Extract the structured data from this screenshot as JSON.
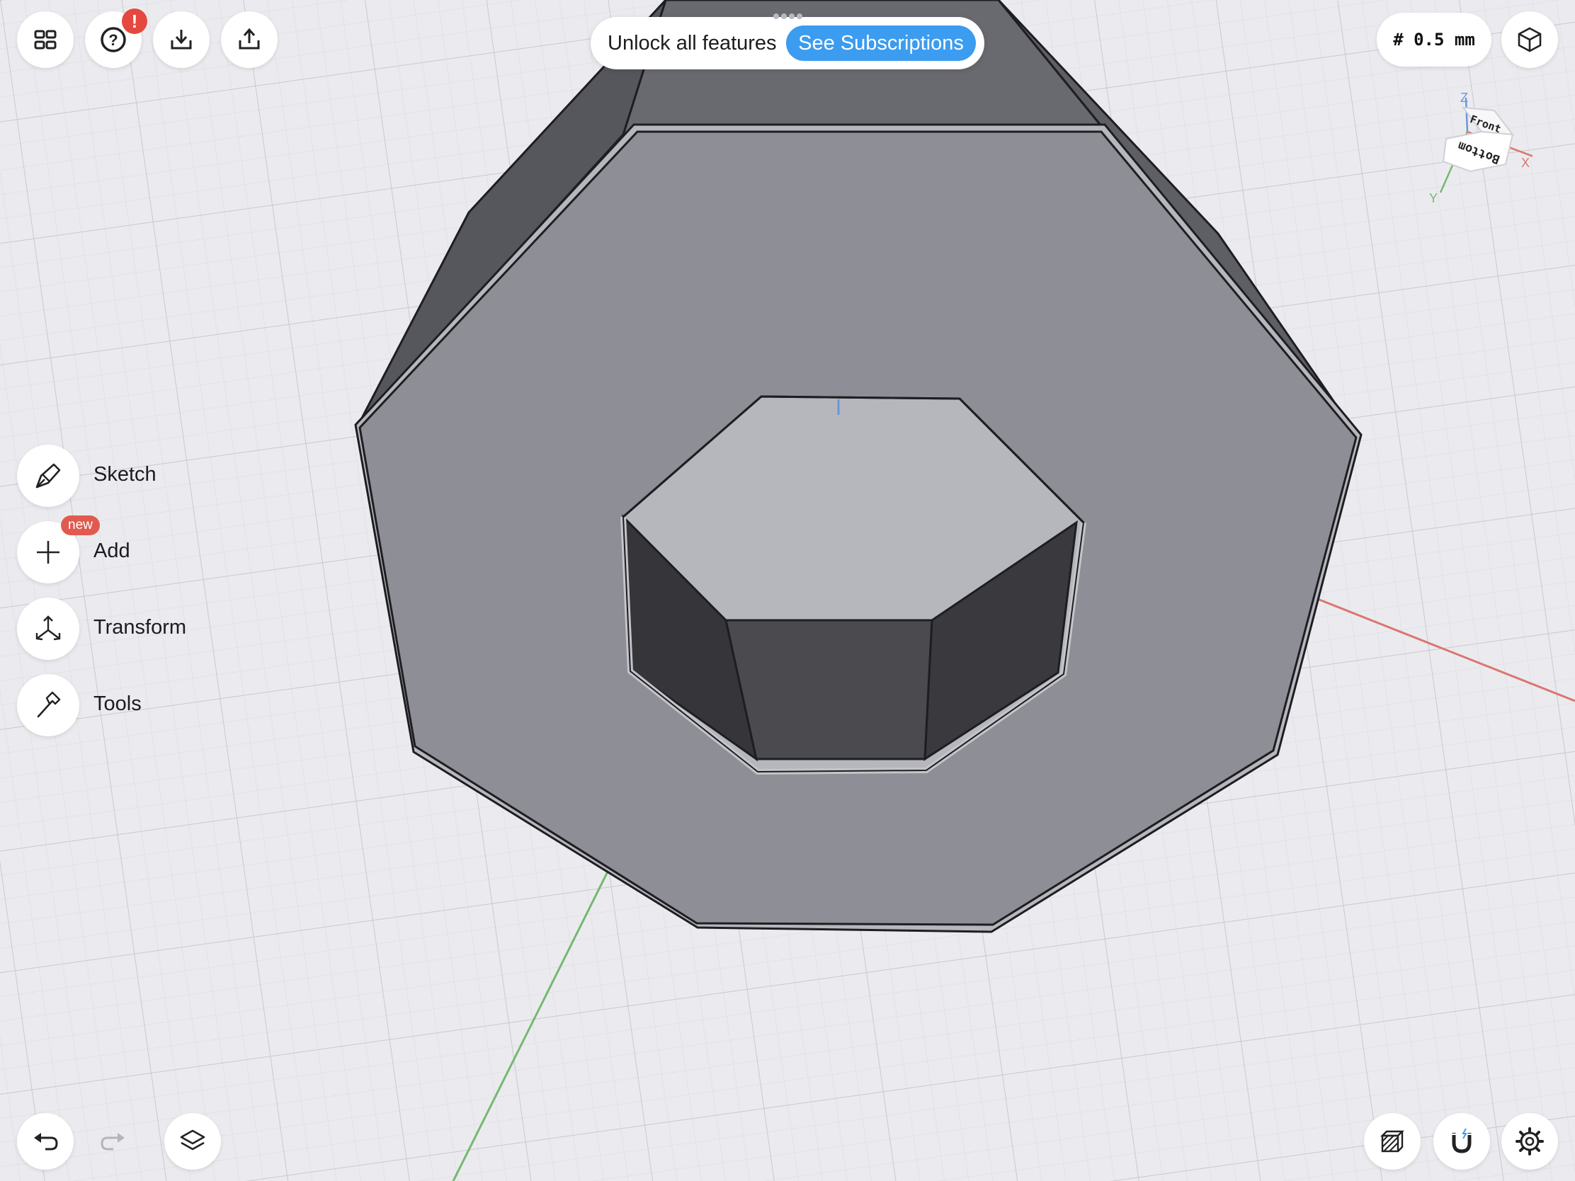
{
  "top_bar": {
    "gallery_icon": "grid-2x2-icon",
    "help_icon": "question-circle-icon",
    "help_badge": "!",
    "import_icon": "tray-download-icon",
    "export_icon": "tray-upload-icon",
    "unlock_text": "Unlock all features",
    "subscriptions_label": "See Subscriptions",
    "grid_size": "# 0.5 mm",
    "view_mode_icon": "cube-projection-icon"
  },
  "view_cube": {
    "top_face": "Front",
    "front_face": "Bottom",
    "axes": {
      "z": "Z",
      "x": "X",
      "y": "Y"
    },
    "colors": {
      "x": "#d9776f",
      "y": "#74b96f",
      "z": "#6c97d8"
    }
  },
  "left_menu": {
    "items": [
      {
        "label": "Sketch",
        "icon": "pen-nib-icon"
      },
      {
        "label": "Add",
        "icon": "plus-icon",
        "badge": "new"
      },
      {
        "label": "Transform",
        "icon": "transform-arrows-icon"
      },
      {
        "label": "Tools",
        "icon": "hammer-icon"
      }
    ]
  },
  "bottom_bar": {
    "undo_icon": "undo-arrow-icon",
    "redo_icon": "redo-arrow-icon",
    "layers_icon": "layers-icon",
    "render_style_icon": "shaded-cube-icon",
    "snap_icon": "magnet-icon",
    "settings_icon": "gear-icon"
  },
  "colors": {
    "accent": "#3b9cf0",
    "alert": "#e5483f",
    "canvas": "#ebebef",
    "axis_x": "#d9776f",
    "axis_y": "#74b96f",
    "axis_z": "#6c97d8"
  }
}
